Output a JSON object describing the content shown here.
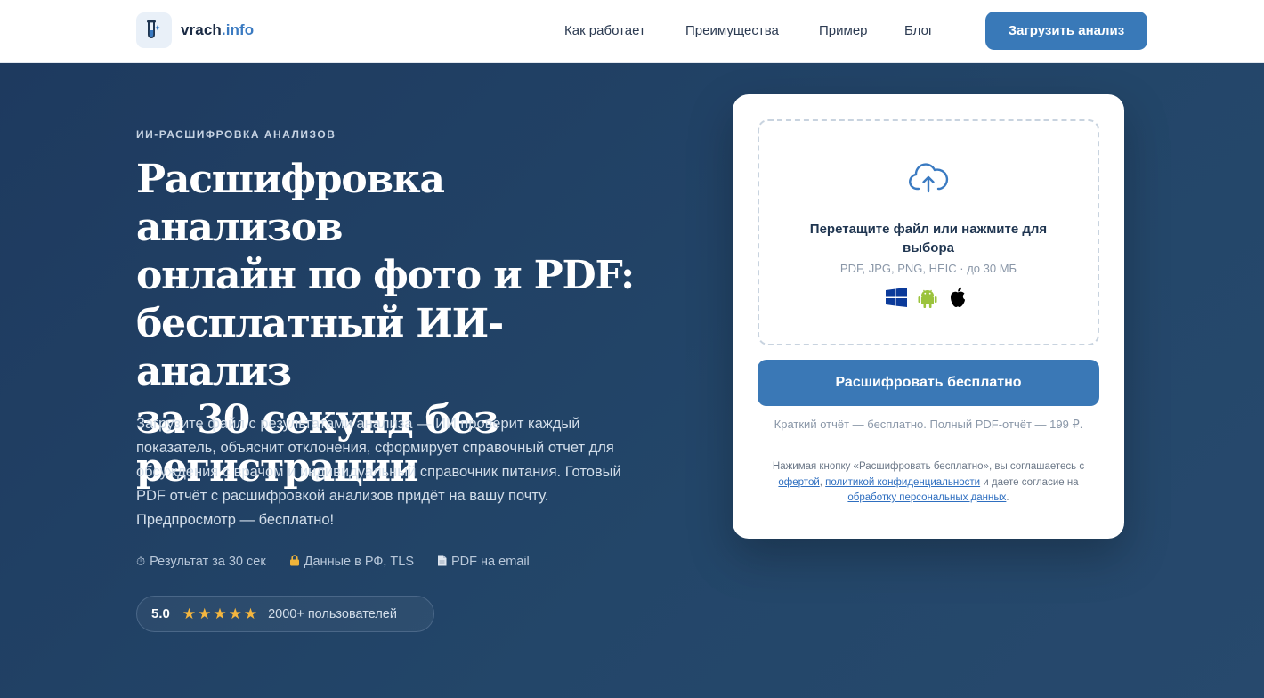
{
  "header": {
    "logo_main": "vrach",
    "logo_tld": ".info",
    "nav": [
      "Как работает",
      "Преимущества",
      "Пример",
      "Блог"
    ],
    "cta": "Загрузить анализ"
  },
  "hero": {
    "eyebrow": "ИИ-РАСШИФРОВКА АНАЛИЗОВ",
    "title_lines": [
      "Расшифровка анализов",
      "онлайн по фото и PDF:",
      "бесплатный ИИ-анализ",
      "за 30 секунд без",
      "регистрации"
    ],
    "lead": "Загрузите файл с результатами анализа — ИИ проверит каждый показатель, объяснит отклонения, сформирует справочный отчет для обсуждения с врачом и индивидуальный справочник питания. Готовый PDF отчёт с расшифровкой анализов придёт на вашу почту. Предпросмотр — бесплатно!",
    "features": [
      {
        "icon": "timer-icon",
        "text": "Результат за 30 сек"
      },
      {
        "icon": "lock-icon",
        "text": "Данные в РФ, TLS"
      },
      {
        "icon": "document-icon",
        "text": "PDF на email"
      }
    ],
    "rating": {
      "score": "5.0",
      "stars": 5,
      "users": "2000+ пользователей"
    }
  },
  "upload": {
    "drop_title": "Перетащите файл или нажмите для выбора",
    "formats": "PDF, JPG, PNG, HEIC · до 30 МБ",
    "os_icons": [
      "windows-icon",
      "android-icon",
      "apple-icon"
    ],
    "button": "Расшифровать бесплатно",
    "price_note": "Краткий отчёт — бесплатно. Полный PDF-отчёт — 199 ₽.",
    "legal": {
      "part1": "Нажимая кнопку «Расшифровать бесплатно», вы соглашаетесь с ",
      "link1": "офертой",
      "sep": ", ",
      "link2": "политикой конфиденциальности",
      "part2": " и даете согласие на ",
      "link3": "обработку персональных данных",
      "part3": "."
    }
  },
  "colors": {
    "accent": "#3979b8",
    "hero_bg": "#1f3d63",
    "star": "#f4b63f"
  }
}
